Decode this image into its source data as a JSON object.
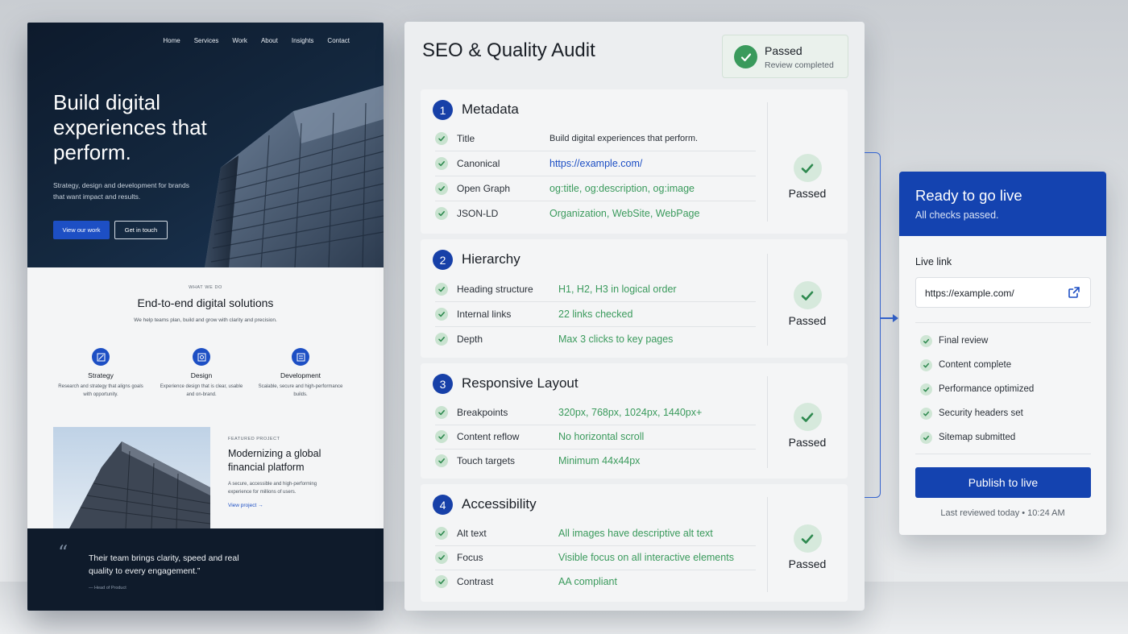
{
  "website": {
    "nav": [
      "Home",
      "Services",
      "Work",
      "About",
      "Insights",
      "Contact"
    ],
    "hero": {
      "title": "Build digital experiences that perform.",
      "subtitle": "Strategy, design and development for brands that want impact and results.",
      "primary_button": "View our work",
      "secondary_button": "Get in touch"
    },
    "services": {
      "eyebrow": "WHAT WE DO",
      "title": "End-to-end digital solutions",
      "subtitle": "We help teams plan, build and grow with clarity and precision.",
      "items": [
        {
          "name": "Strategy",
          "desc": "Research and strategy that aligns goals with opportunity.",
          "icon": "strategy-icon"
        },
        {
          "name": "Design",
          "desc": "Experience design that is clear, usable and on-brand.",
          "icon": "design-icon"
        },
        {
          "name": "Development",
          "desc": "Scalable, secure and high-performance builds.",
          "icon": "development-icon"
        }
      ]
    },
    "featured": {
      "eyebrow": "FEATURED PROJECT",
      "title": "Modernizing a global financial platform",
      "desc": "A secure, accessible and high-performing experience for millions of users.",
      "link": "View project →"
    },
    "quote": {
      "mark": "“",
      "text": "Their team brings clarity, speed and real quality to every engagement.”",
      "author": "— Head of Product"
    }
  },
  "audit": {
    "title": "SEO & Quality Audit",
    "badge": {
      "title": "Passed",
      "subtitle": "Review completed"
    },
    "sections": [
      {
        "number": "1",
        "title": "Metadata",
        "status": "Passed",
        "rows": [
          {
            "label": "Title",
            "value": "Build digital experiences that perform."
          },
          {
            "label": "Canonical",
            "value": "https://example.com/"
          },
          {
            "label": "Open Graph",
            "value": "og:title, og:description, og:image"
          },
          {
            "label": "JSON-LD",
            "value": "Organization, WebSite, WebPage"
          }
        ]
      },
      {
        "number": "2",
        "title": "Hierarchy",
        "status": "Passed",
        "rows": [
          {
            "label": "Heading structure",
            "value": "H1, H2, H3 in logical order"
          },
          {
            "label": "Internal links",
            "value": "22 links checked"
          },
          {
            "label": "Depth",
            "value": "Max 3 clicks to key pages"
          }
        ]
      },
      {
        "number": "3",
        "title": "Responsive Layout",
        "status": "Passed",
        "rows": [
          {
            "label": "Breakpoints",
            "value": "320px, 768px, 1024px, 1440px+"
          },
          {
            "label": "Content reflow",
            "value": "No horizontal scroll"
          },
          {
            "label": "Touch targets",
            "value": "Minimum 44x44px"
          }
        ]
      },
      {
        "number": "4",
        "title": "Accessibility",
        "status": "Passed",
        "rows": [
          {
            "label": "Alt text",
            "value": "All images have descriptive alt text"
          },
          {
            "label": "Focus",
            "value": "Visible focus on all interactive elements"
          },
          {
            "label": "Contrast",
            "value": "AA compliant"
          }
        ]
      }
    ]
  },
  "golive": {
    "title": "Ready to go live",
    "subtitle": "All checks passed.",
    "live_label": "Live link",
    "url": "https://example.com/",
    "checklist": [
      "Final review",
      "Content complete",
      "Performance optimized",
      "Security headers set",
      "Sitemap submitted"
    ],
    "button": "Publish to live",
    "footer": "Last reviewed today • 10:24 AM"
  },
  "colors": {
    "accent": "#1443b0",
    "success": "#3a9a5c",
    "link": "#1d4fc4"
  }
}
